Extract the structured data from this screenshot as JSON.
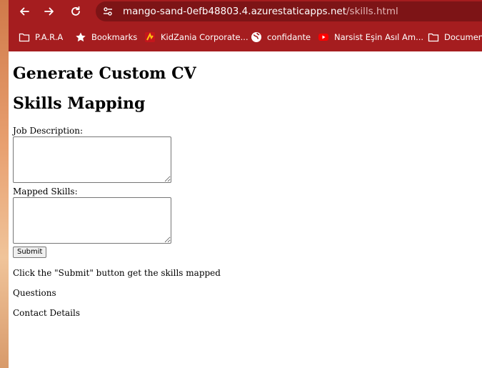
{
  "browser": {
    "url_host": "mango-sand-0efb48803.4.azurestaticapps.net",
    "url_path": "/skills.html",
    "colors": {
      "toolbar": "#a51d1f",
      "omnibox": "#7d1416"
    },
    "bookmarks": [
      {
        "label": "P.A.R.A",
        "icon": "folder-icon"
      },
      {
        "label": "Bookmarks",
        "icon": "star-icon"
      },
      {
        "label": "KidZania Corporate...",
        "icon": "kidzania-icon"
      },
      {
        "label": "confidante",
        "icon": "globe-icon"
      },
      {
        "label": "Narsist Eşin Asıl Am...",
        "icon": "youtube-icon"
      },
      {
        "label": "Documen",
        "icon": "folder-icon"
      }
    ]
  },
  "page": {
    "title": "Generate Custom CV",
    "section_heading": "Skills Mapping",
    "job_description_label": "Job Description:",
    "job_description_value": "",
    "mapped_skills_label": "Mapped Skills:",
    "mapped_skills_value": "",
    "submit_label": "Submit",
    "instructions": "Click the \"Submit\" button get the skills mapped",
    "questions": "Questions",
    "contact": "Contact Details"
  }
}
